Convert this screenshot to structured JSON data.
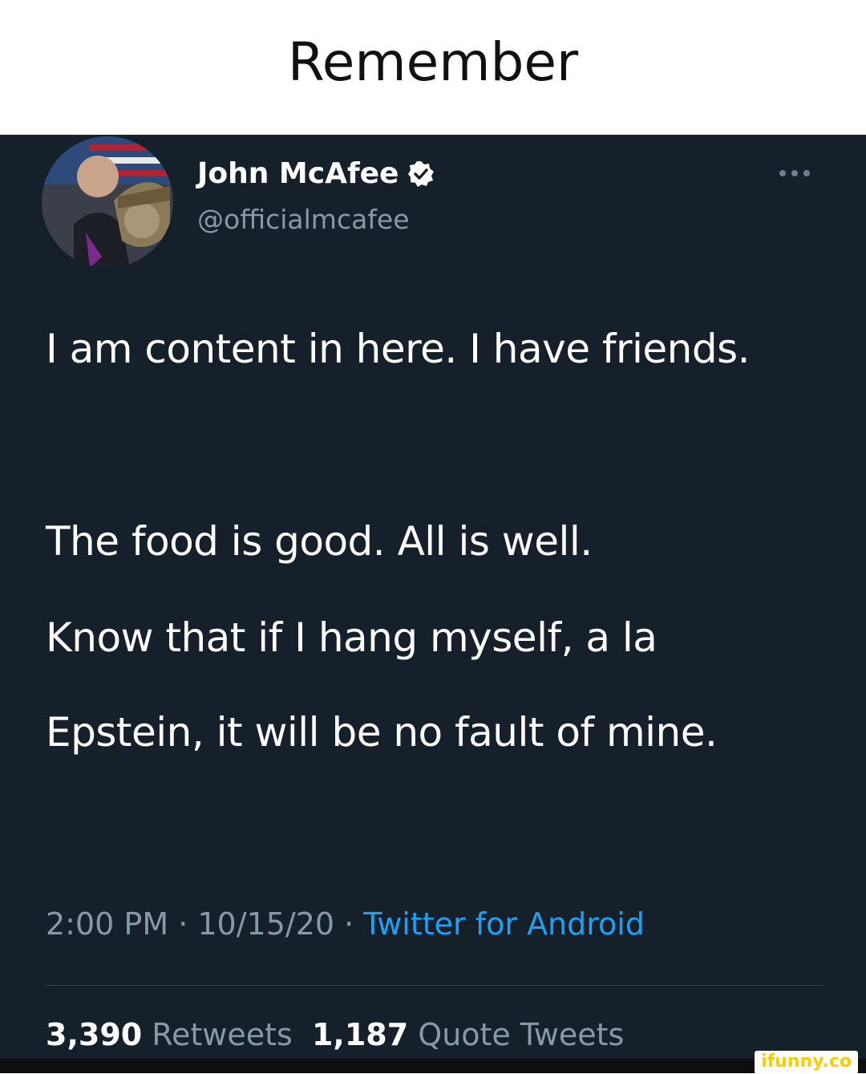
{
  "caption": "Remember",
  "tweet": {
    "display_name": "John McAfee",
    "handle": "@officialmcafee",
    "verified": true,
    "paragraphs": [
      "I am content in here. I have friends.",
      "The food is good. All is well.",
      "Know that if I hang myself, a la Epstein, it will be no fault of mine."
    ],
    "time": "2:00 PM",
    "date": "10/15/20",
    "separator": " · ",
    "source": "Twitter for Android",
    "retweets_count": "3,390",
    "retweets_label": "Retweets",
    "quotes_count": "1,187",
    "quotes_label": "Quote Tweets"
  },
  "watermark": "ifunny.co",
  "icons": {
    "verified": "verified-badge-icon",
    "more": "more-horizontal-icon"
  },
  "colors": {
    "tweet_background": "#15202b",
    "secondary_text": "#8899a6",
    "link": "#1da1f2",
    "watermark": "#ffcc00"
  }
}
